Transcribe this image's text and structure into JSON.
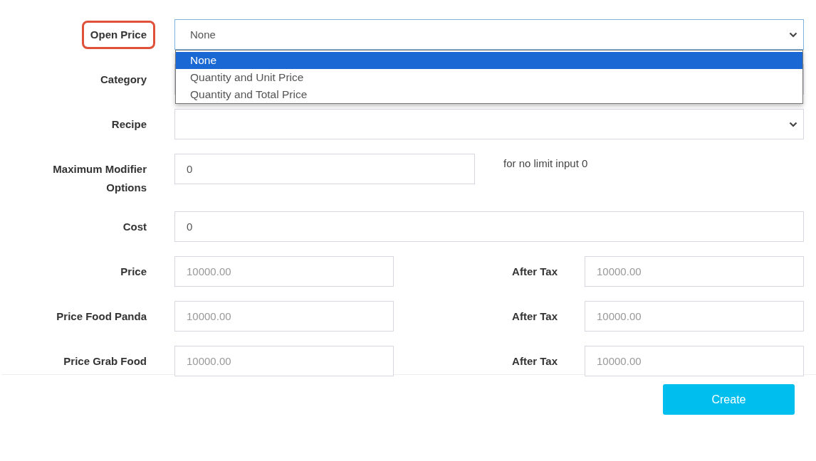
{
  "form": {
    "fields": [
      {
        "kind": "select",
        "label": "Open Price",
        "highlighted": true,
        "value": "None",
        "open": true,
        "options": [
          {
            "label": "None",
            "selected": true
          },
          {
            "label": "Quantity and Unit Price",
            "selected": false
          },
          {
            "label": "Quantity and Total Price",
            "selected": false
          }
        ]
      },
      {
        "kind": "select",
        "label": "Category",
        "highlighted": false
      },
      {
        "kind": "select",
        "label": "Recipe",
        "highlighted": false
      },
      {
        "kind": "short_input",
        "label": "Maximum Modifier Options",
        "highlighted": false,
        "value": "0",
        "hint": "for no limit input 0"
      },
      {
        "kind": "input",
        "label": "Cost",
        "highlighted": false,
        "value": "0"
      },
      {
        "kind": "price",
        "label": "Price",
        "highlighted": false,
        "placeholder": "10000.00",
        "after_tax": {
          "label": "After Tax",
          "placeholder": "10000.00"
        }
      },
      {
        "kind": "price",
        "label": "Price Food Panda",
        "highlighted": false,
        "placeholder": "10000.00",
        "after_tax": {
          "label": "After Tax",
          "placeholder": "10000.00"
        }
      },
      {
        "kind": "price",
        "label": "Price Grab Food",
        "highlighted": false,
        "placeholder": "10000.00",
        "after_tax": {
          "label": "After Tax",
          "placeholder": "10000.00"
        }
      }
    ]
  },
  "footer": {
    "buttons": [
      {
        "label": "Create"
      }
    ]
  }
}
